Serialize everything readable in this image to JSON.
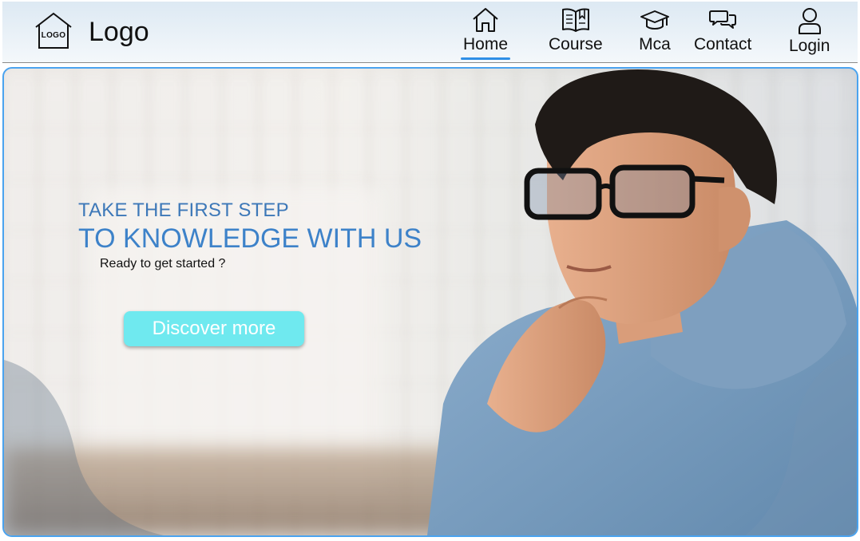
{
  "brand": {
    "logo_mark": "LOGO",
    "logo_text": "Logo"
  },
  "nav": {
    "items": [
      {
        "label": "Home",
        "icon": "home-icon",
        "active": true
      },
      {
        "label": "Course",
        "icon": "book-icon",
        "active": false
      },
      {
        "label": "Mca",
        "icon": "graduation-cap-icon",
        "active": false
      },
      {
        "label": "Contact",
        "icon": "chat-icon",
        "active": false
      },
      {
        "label": "Login",
        "icon": "user-icon",
        "active": false
      }
    ],
    "active_color": "#2f8fe6"
  },
  "hero": {
    "line1": "TAKE THE FIRST STEP",
    "line2": "TO KNOWLEDGE WITH US",
    "subtitle": "Ready to get started ?",
    "cta_label": "Discover more",
    "accent_color": "#3d82c9",
    "cta_color": "#6fe9ef",
    "border_color": "#4aa3ef"
  }
}
